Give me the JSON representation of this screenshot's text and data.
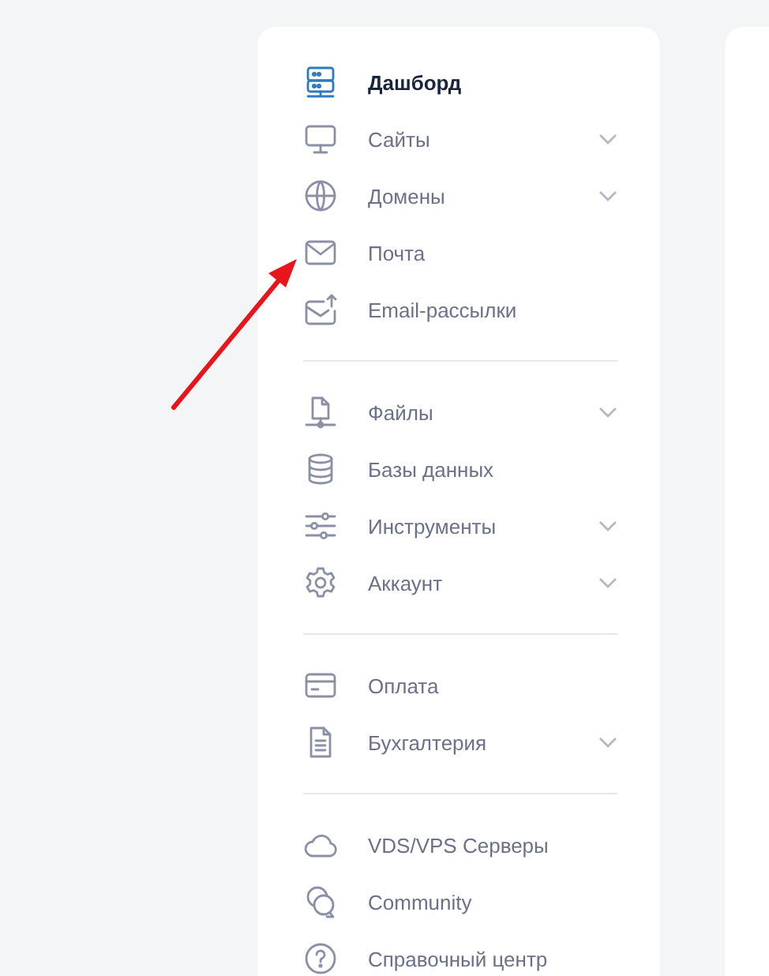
{
  "sidebar": {
    "groups": [
      {
        "items": [
          {
            "label": "Дашборд",
            "selected": true,
            "has_submenu": false
          },
          {
            "label": "Сайты",
            "selected": false,
            "has_submenu": true
          },
          {
            "label": "Домены",
            "selected": false,
            "has_submenu": true
          },
          {
            "label": "Почта",
            "selected": false,
            "has_submenu": false
          },
          {
            "label": "Email-рассылки",
            "selected": false,
            "has_submenu": false
          }
        ]
      },
      {
        "items": [
          {
            "label": "Файлы",
            "selected": false,
            "has_submenu": true
          },
          {
            "label": "Базы данных",
            "selected": false,
            "has_submenu": false
          },
          {
            "label": "Инструменты",
            "selected": false,
            "has_submenu": true
          },
          {
            "label": "Аккаунт",
            "selected": false,
            "has_submenu": true
          }
        ]
      },
      {
        "items": [
          {
            "label": "Оплата",
            "selected": false,
            "has_submenu": false
          },
          {
            "label": "Бухгалтерия",
            "selected": false,
            "has_submenu": true
          }
        ]
      },
      {
        "items": [
          {
            "label": "VDS/VPS Серверы",
            "selected": false,
            "has_submenu": false
          },
          {
            "label": "Community",
            "selected": false,
            "has_submenu": false
          },
          {
            "label": "Справочный центр",
            "selected": false,
            "has_submenu": false
          }
        ]
      }
    ]
  }
}
